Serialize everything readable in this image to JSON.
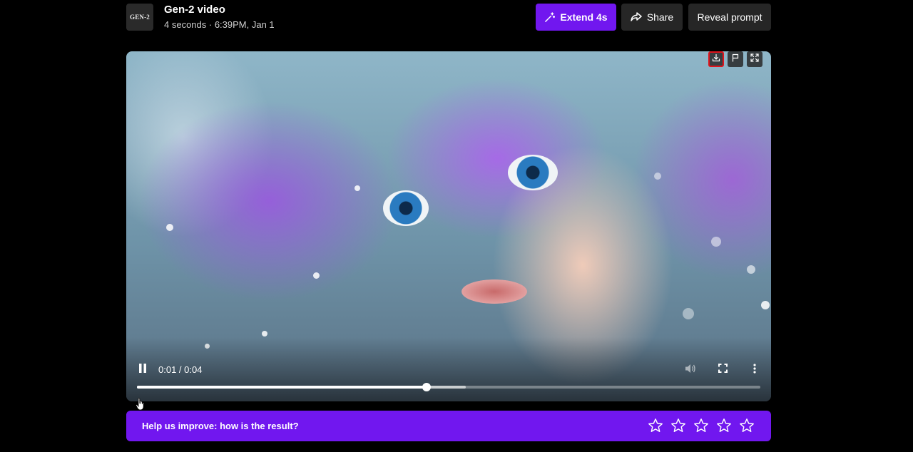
{
  "header": {
    "logo_text": "GEN-2",
    "title": "Gen-2 video",
    "subtitle": "4 seconds · 6:39PM, Jan 1"
  },
  "actions": {
    "extend_label": "Extend 4s",
    "share_label": "Share",
    "reveal_label": "Reveal prompt"
  },
  "player": {
    "time_display": "0:01 / 0:04",
    "progress_fraction": 0.465,
    "buffered_fraction": 0.528,
    "overlay_icons": [
      "download-icon",
      "flag-icon",
      "expand-icon"
    ],
    "control_icons": [
      "pause-icon",
      "volume-icon",
      "fullscreen-icon",
      "more-vertical-icon"
    ]
  },
  "feedback": {
    "prompt": "Help us improve: how is the result?",
    "stars": [
      1,
      2,
      3,
      4,
      5
    ]
  },
  "colors": {
    "accent": "#7117ef",
    "secondary_button": "#262626",
    "highlight_border": "#e0131b",
    "background": "#000000"
  }
}
